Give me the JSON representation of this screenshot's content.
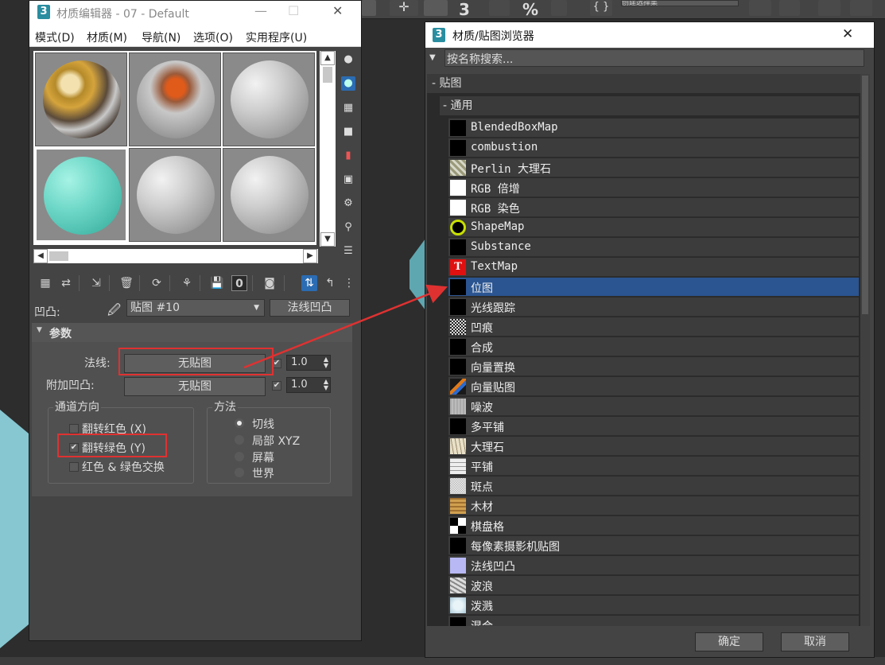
{
  "main_toolbar": {
    "number_label": "3",
    "percent_label": "%",
    "selection_set_placeholder": "创建选择集"
  },
  "material_editor": {
    "title": "材质编辑器 - 07 - Default",
    "logo": "3",
    "menu": [
      "模式(D)",
      "材质(M)",
      "导航(N)",
      "选项(O)",
      "实用程序(U)"
    ],
    "slots": [
      {
        "name": "slot-1",
        "style": "textured-gold"
      },
      {
        "name": "slot-2",
        "style": "glass-orange"
      },
      {
        "name": "slot-3",
        "style": "gray"
      },
      {
        "name": "slot-4",
        "style": "cyan",
        "selected": true
      },
      {
        "name": "slot-5",
        "style": "gray"
      },
      {
        "name": "slot-6",
        "style": "gray"
      }
    ],
    "bump_label": "凹凸:",
    "map_combo_value": "贴图 #10",
    "map_type_button": "法线凹凸",
    "params_title": "参数",
    "normal_label": "法线:",
    "normal_button": "无贴图",
    "normal_amount": "1.0",
    "additional_bump_label": "附加凹凸:",
    "additional_bump_button": "无贴图",
    "additional_amount": "1.0",
    "channel_group_title": "通道方向",
    "flip_red": "翻转红色 (X)",
    "flip_green": "翻转绿色 (Y)",
    "swap_rg": "红色 & 绿色交换",
    "method_group_title": "方法",
    "methods": [
      "切线",
      "局部 XYZ",
      "屏幕",
      "世界"
    ],
    "method_selected": "切线",
    "flip_green_checked": true,
    "toolbar_number": "0"
  },
  "browser": {
    "title": "材质/贴图浏览器",
    "logo": "3",
    "search_placeholder": "按名称搜索...",
    "category_maps": "- 贴图",
    "category_general": "- 通用",
    "items": [
      {
        "label": "BlendedBoxMap",
        "swatch": "black"
      },
      {
        "label": "combustion",
        "swatch": "black"
      },
      {
        "label": "Perlin 大理石",
        "swatch": "perlin"
      },
      {
        "label": "RGB 倍增",
        "swatch": "white"
      },
      {
        "label": "RGB 染色",
        "swatch": "white"
      },
      {
        "label": "ShapeMap",
        "swatch": "shape"
      },
      {
        "label": "Substance",
        "swatch": "black"
      },
      {
        "label": "TextMap",
        "swatch": "text"
      },
      {
        "label": "位图",
        "swatch": "black",
        "selected": true
      },
      {
        "label": "光线跟踪",
        "swatch": "black"
      },
      {
        "label": "凹痕",
        "swatch": "noise"
      },
      {
        "label": "合成",
        "swatch": "black"
      },
      {
        "label": "向量置换",
        "swatch": "black"
      },
      {
        "label": "向量贴图",
        "swatch": "vector"
      },
      {
        "label": "噪波",
        "swatch": "gray"
      },
      {
        "label": "多平铺",
        "swatch": "black"
      },
      {
        "label": "大理石",
        "swatch": "marble"
      },
      {
        "label": "平铺",
        "swatch": "tile"
      },
      {
        "label": "斑点",
        "swatch": "speckle"
      },
      {
        "label": "木材",
        "swatch": "wood"
      },
      {
        "label": "棋盘格",
        "swatch": "checker"
      },
      {
        "label": "每像素摄影机贴图",
        "swatch": "black"
      },
      {
        "label": "法线凹凸",
        "swatch": "lavender"
      },
      {
        "label": "波浪",
        "swatch": "wave"
      },
      {
        "label": "泼溅",
        "swatch": "splat"
      },
      {
        "label": "混合",
        "swatch": "black"
      }
    ],
    "ok_button": "确定",
    "cancel_button": "取消"
  },
  "colors": {
    "highlight_box": "#e03131",
    "selected_row": "#2b5591"
  }
}
